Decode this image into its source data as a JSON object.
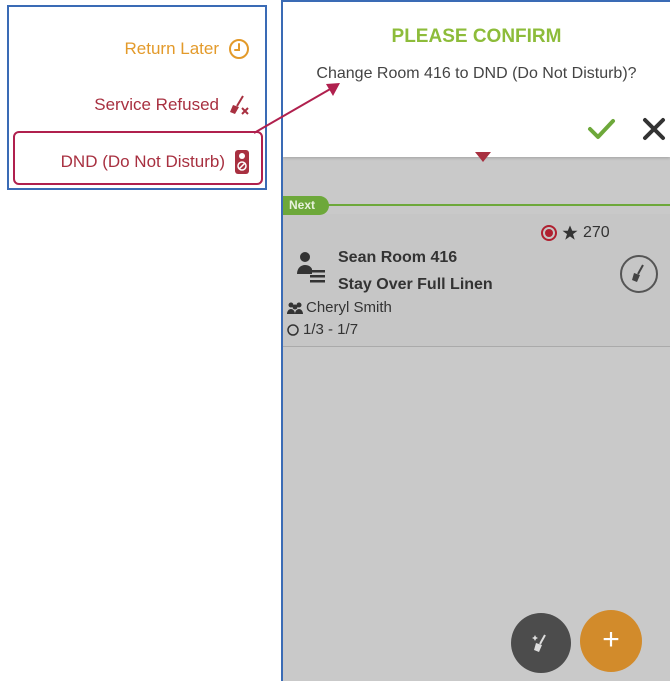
{
  "status_menu": {
    "return_later": {
      "label": "Return Later",
      "icon": "clock-icon",
      "color": "#e39a2a"
    },
    "service_refused": {
      "label": "Service Refused",
      "icon": "broom-x-icon",
      "color": "#a83040"
    },
    "dnd": {
      "label": "DND (Do Not Disturb)",
      "icon": "door-hanger-icon",
      "color": "#a83040"
    }
  },
  "dialog": {
    "title": "PLEASE CONFIRM",
    "message": "Change Room 416 to DND (Do Not Disturb)?",
    "confirm_icon": "check-icon",
    "cancel_icon": "close-icon"
  },
  "list": {
    "badge": "Next",
    "card": {
      "priority": "270",
      "room": "Sean Room 416",
      "service": "Stay Over Full Linen",
      "attendant": "Cheryl Smith",
      "dates": "1/3 - 1/7"
    }
  },
  "colors": {
    "accent_green": "#8dbc3a",
    "dnd_red": "#a83040",
    "fab_orange": "#d28b2b",
    "border_blue": "#3a6bb5"
  }
}
